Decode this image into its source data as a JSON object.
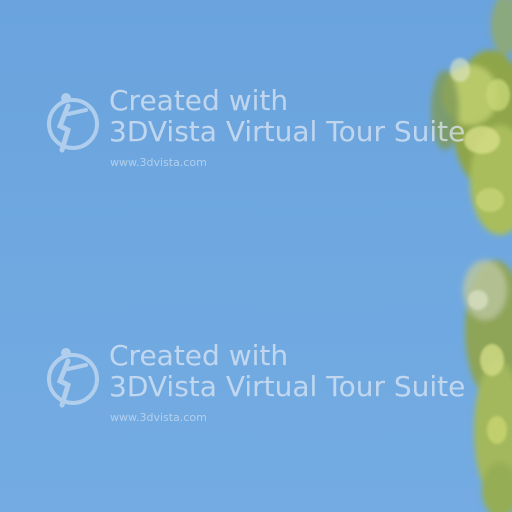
{
  "watermarks": [
    {
      "line1": "Created with",
      "line2": "3DVista Virtual Tour Suite",
      "url": "www.3dvista.com"
    },
    {
      "line1": "Created with",
      "line2": "3DVista Virtual Tour Suite",
      "url": "www.3dvista.com"
    }
  ],
  "colors": {
    "sky": "#6fa8e0",
    "foliage_light": "#c9d97a",
    "foliage_dark": "#6f8f3a",
    "watermark_text": "#dfe9f5"
  }
}
